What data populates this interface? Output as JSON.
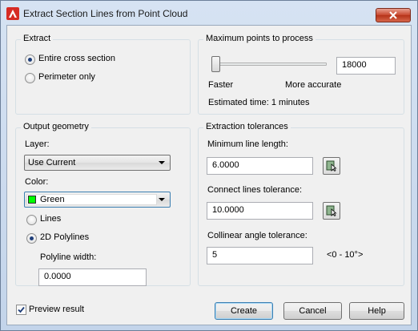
{
  "window": {
    "title": "Extract Section Lines from Point Cloud"
  },
  "extract": {
    "group_label": "Extract",
    "options": [
      "Entire cross section",
      "Perimeter only"
    ],
    "selected": "Entire cross section"
  },
  "max_points": {
    "group_label": "Maximum points to process",
    "value": "18000",
    "slider_min_label": "Faster",
    "slider_max_label": "More accurate",
    "slider_fraction": 0.0,
    "estimated_time": "Estimated time: 1 minutes"
  },
  "output": {
    "group_label": "Output geometry",
    "layer_label": "Layer:",
    "layer_value": "Use Current",
    "color_label": "Color:",
    "color_value": "Green",
    "color_swatch": "#00ff00",
    "geometry_options": [
      "Lines",
      "2D Polylines"
    ],
    "selected_geometry": "2D Polylines",
    "polyline_width_label": "Polyline width:",
    "polyline_width_value": "0.0000"
  },
  "tolerances": {
    "group_label": "Extraction tolerances",
    "min_line_label": "Minimum line length:",
    "min_line_value": "6.0000",
    "connect_label": "Connect lines tolerance:",
    "connect_value": "10.0000",
    "collinear_label": "Collinear angle tolerance:",
    "collinear_value": "5",
    "collinear_range": "<0 - 10°>"
  },
  "footer": {
    "preview_label": "Preview result",
    "preview_checked": true,
    "create_label": "Create",
    "cancel_label": "Cancel",
    "help_label": "Help"
  }
}
